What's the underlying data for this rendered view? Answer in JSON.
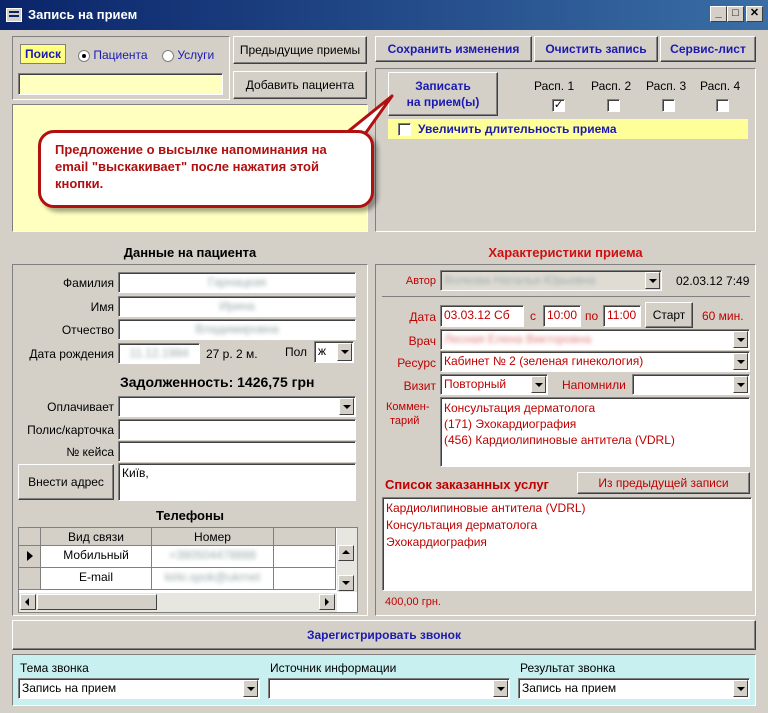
{
  "window": {
    "title": "Запись на прием",
    "btn_min": "_",
    "btn_max": "□",
    "btn_close": "✕"
  },
  "search": {
    "label": "Поиск",
    "radio_patients": "Пациента",
    "radio_services": "Услуги",
    "input_value": "",
    "btn_prev": "Предыдущие приемы",
    "btn_add_patient": "Добавить пациента"
  },
  "toolbar": {
    "save": "Сохранить изменения",
    "clear": "Очистить запись",
    "service_sheet": "Сервис-лист"
  },
  "appointment": {
    "btn_book_line1": "Записать",
    "btn_book_line2": "на прием(ы)",
    "schedules": [
      "Расп. 1",
      "Расп. 2",
      "Расп. 3",
      "Расп. 4"
    ],
    "schedule_checked": [
      true,
      false,
      false,
      false
    ],
    "check_mark": "✓",
    "extend_label": "Увеличить длительность приема"
  },
  "callout": {
    "text": "Предложение о высылке напоминания на email \"выскакивает\" после нажатия этой кнопки."
  },
  "patient": {
    "header": "Данные на пациента",
    "surname_label": "Фамилия",
    "surname": "Гарнацкая",
    "name_label": "Имя",
    "name": "Ирина",
    "patronymic_label": "Отчество",
    "patronymic": "Владимировна",
    "dob_label": "Дата рождения",
    "dob": "11.12.1984",
    "age": "27 р. 2 м.",
    "sex_label": "Пол",
    "sex": "ж",
    "debt": "Задолженность: 1426,75 грн",
    "payer_label": "Оплачивает",
    "payer": "",
    "policy_label": "Полис/карточка",
    "policy": "",
    "case_label": "№ кейса",
    "case": "",
    "address_btn": "Внести адрес",
    "address": "Київ,"
  },
  "phones": {
    "header": "Телефоны",
    "col_type": "Вид связи",
    "col_number": "Номер",
    "rows": [
      {
        "type": "Мобильный",
        "number": "+380504478888"
      },
      {
        "type": "E-mail",
        "number": "kirki.spok@ukrnet"
      }
    ]
  },
  "visit": {
    "header": "Характеристики приема",
    "author_label": "Автор",
    "author": "Волкова Наталья Юрьевна",
    "author_date": "02.03.12 7:49",
    "date_label": "Дата",
    "date": "03.03.12 Сб",
    "from_label": "с",
    "from": "10:00",
    "to_label": "по",
    "to": "11:00",
    "start_btn": "Старт",
    "duration": "60 мин.",
    "doctor_label": "Врач",
    "doctor": "Лесная Елена Викторовна",
    "resource_label": "Ресурс",
    "resource": "Кабинет № 2 (зеленая гинекология)",
    "visit_label": "Визит",
    "visit_type": "Повторный",
    "reminder_label": "Напомнили",
    "reminder": "",
    "comment_label_1": "Коммен-",
    "comment_label_2": "тарий",
    "comment_lines": [
      "Консультация дерматолога",
      "(171) Эхокардиография",
      "(456) Кардиолипиновые антитела (VDRL)"
    ],
    "services_label": "Список заказанных услуг",
    "from_prev_btn": "Из предыдущей записи",
    "services": [
      "Кардиолипиновые антитела (VDRL)",
      "Консультация дерматолога",
      "Эхокардиография"
    ],
    "total": "400,00 грн."
  },
  "call": {
    "register_btn": "Зарегистрировать звонок",
    "topic_label": "Тема звонка",
    "topic": "Запись на прием",
    "source_label": "Источник информации",
    "source": "",
    "result_label": "Результат звонка",
    "result": "Запись на прием"
  }
}
